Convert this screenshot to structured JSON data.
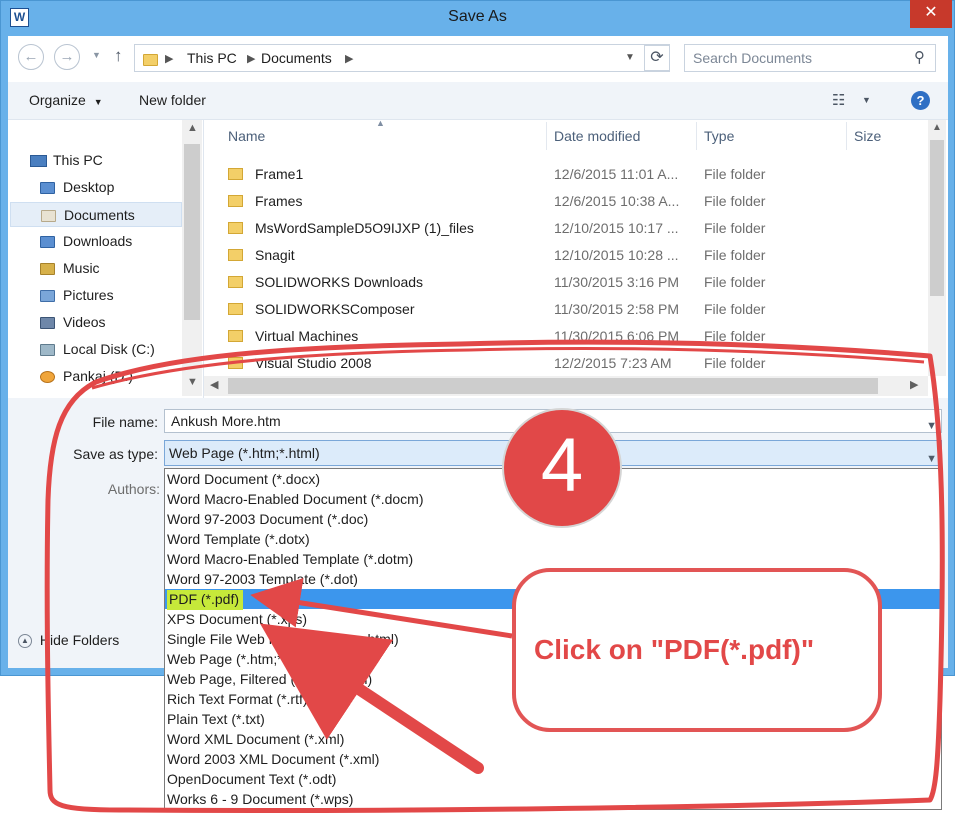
{
  "window": {
    "title": "Save As",
    "app_icon_letter": "W",
    "close_glyph": "✕"
  },
  "address": {
    "segments": [
      "This PC",
      "Documents"
    ],
    "search_placeholder": "Search Documents"
  },
  "toolbar": {
    "organize": "Organize",
    "new_folder": "New folder"
  },
  "nav": {
    "items": [
      {
        "label": "This PC",
        "selected": false
      },
      {
        "label": "Desktop",
        "selected": false
      },
      {
        "label": "Documents",
        "selected": true
      },
      {
        "label": "Downloads",
        "selected": false
      },
      {
        "label": "Music",
        "selected": false
      },
      {
        "label": "Pictures",
        "selected": false
      },
      {
        "label": "Videos",
        "selected": false
      },
      {
        "label": "Local Disk (C:)",
        "selected": false
      },
      {
        "label": "Pankaj (D:)",
        "selected": false
      }
    ]
  },
  "columns": {
    "name": "Name",
    "date": "Date modified",
    "type": "Type",
    "size": "Size"
  },
  "files": [
    {
      "name": "Frame1",
      "date": "12/6/2015 11:01 A...",
      "type": "File folder"
    },
    {
      "name": "Frames",
      "date": "12/6/2015 10:38 A...",
      "type": "File folder"
    },
    {
      "name": "MsWordSampleD5O9IJXP (1)_files",
      "date": "12/10/2015 10:17 ...",
      "type": "File folder"
    },
    {
      "name": "Snagit",
      "date": "12/10/2015 10:28 ...",
      "type": "File folder"
    },
    {
      "name": "SOLIDWORKS Downloads",
      "date": "11/30/2015 3:16 PM",
      "type": "File folder"
    },
    {
      "name": "SOLIDWORKSComposer",
      "date": "11/30/2015 2:58 PM",
      "type": "File folder"
    },
    {
      "name": "Virtual Machines",
      "date": "11/30/2015 6:06 PM",
      "type": "File folder"
    },
    {
      "name": "Visual Studio 2008",
      "date": "12/2/2015 7:23 AM",
      "type": "File folder"
    }
  ],
  "form": {
    "file_name_label": "File name:",
    "file_name_value": "Ankush More.htm",
    "save_type_label": "Save as type:",
    "save_type_value": "Web Page (*.htm;*.html)",
    "authors_label": "Authors:",
    "hide_folders": "Hide Folders"
  },
  "save_types": [
    {
      "label": "Word Document (*.docx)",
      "selected": false
    },
    {
      "label": "Word Macro-Enabled Document (*.docm)",
      "selected": false
    },
    {
      "label": "Word 97-2003 Document (*.doc)",
      "selected": false
    },
    {
      "label": "Word Template (*.dotx)",
      "selected": false
    },
    {
      "label": "Word Macro-Enabled Template (*.dotm)",
      "selected": false
    },
    {
      "label": "Word 97-2003 Template (*.dot)",
      "selected": false
    },
    {
      "label": "PDF (*.pdf)",
      "selected": true
    },
    {
      "label": "XPS Document (*.xps)",
      "selected": false
    },
    {
      "label": "Single File Web Page (*.mht;*.mhtml)",
      "selected": false
    },
    {
      "label": "Web Page (*.htm;*.html)",
      "selected": false
    },
    {
      "label": "Web Page, Filtered (*.htm;*.html)",
      "selected": false
    },
    {
      "label": "Rich Text Format (*.rtf)",
      "selected": false
    },
    {
      "label": "Plain Text (*.txt)",
      "selected": false
    },
    {
      "label": "Word XML Document (*.xml)",
      "selected": false
    },
    {
      "label": "Word 2003 XML Document (*.xml)",
      "selected": false
    },
    {
      "label": "OpenDocument Text (*.odt)",
      "selected": false
    },
    {
      "label": "Works 6 - 9 Document (*.wps)",
      "selected": false
    }
  ],
  "annotation": {
    "step_number": "4",
    "callout": "Click on \"PDF(*.pdf)\"",
    "color": "#e24848"
  }
}
